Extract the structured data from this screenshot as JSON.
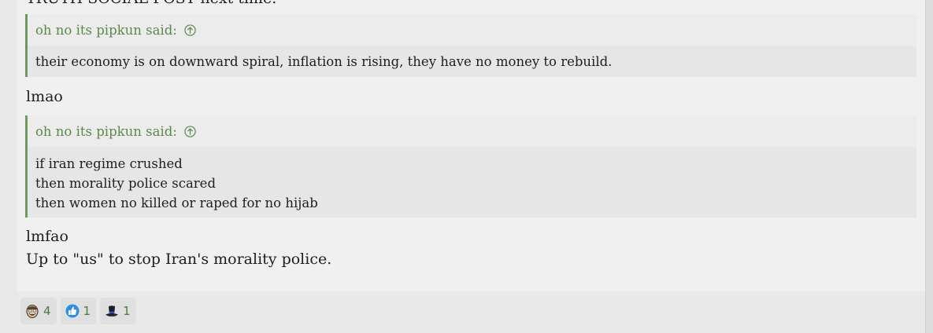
{
  "post": {
    "cut_line": "TRUTH SOCIAL POST next time.",
    "quote1": {
      "author_label": "oh no its pipkun said:",
      "lines": [
        "their economy is on downward spiral, inflation is rising, they have no money to rebuild."
      ]
    },
    "reply1": "lmao",
    "quote2": {
      "author_label": "oh no its pipkun said:",
      "lines": [
        "if iran regime crushed",
        "then morality police scared",
        "then women no killed or raped for no hijab"
      ]
    },
    "reply2": "lmfao",
    "reply3": "Up to \"us\" to stop Iran's morality police."
  },
  "reactions": [
    {
      "icon": "laughing-face-icon",
      "count": "4"
    },
    {
      "icon": "thumbs-up-icon",
      "count": "1"
    },
    {
      "icon": "top-hat-icon",
      "count": "1"
    }
  ],
  "colors": {
    "quote_accent": "#6c9a5b",
    "quote_author": "#5a8a4a",
    "post_background": "#f0f0f0"
  }
}
